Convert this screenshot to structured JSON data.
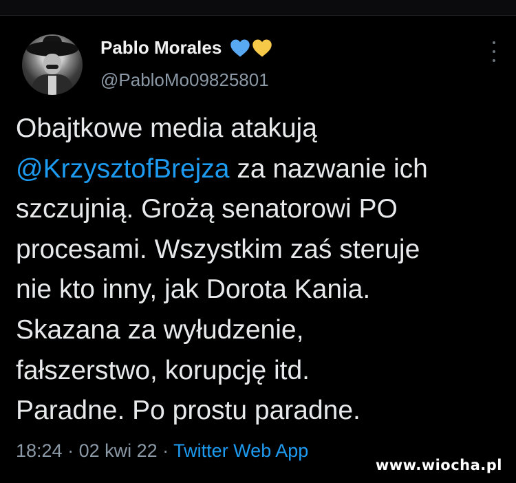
{
  "author": {
    "name": "Pablo Morales",
    "handle": "@PabloMo09825801",
    "hearts": [
      "blue-heart",
      "yellow-heart"
    ]
  },
  "tweet": {
    "line1": "Obajtkowe media atakują",
    "mention": "@KrzysztofBrejza",
    "line2_rest": " za nazwanie ich",
    "rest": "szczujnią. Grożą senatorowi PO\nprocesami. Wszystkim zaś steruje\nnie kto inny, jak Dorota Kania.\nSkazana za wyłudzenie,\nfałszerstwo, korupcję itd.\nParadne. Po prostu paradne."
  },
  "meta": {
    "time": "18:24",
    "sep1": " · ",
    "date": "02 kwi 22",
    "sep2": " · ",
    "source": "Twitter Web App"
  },
  "watermark": "www.wiocha.pl",
  "colors": {
    "background": "#000000",
    "text": "#e7e9ea",
    "secondary": "#8b98a5",
    "link": "#1d9bf0",
    "heart_blue": "#59a8f2",
    "heart_yellow": "#f7c948"
  }
}
